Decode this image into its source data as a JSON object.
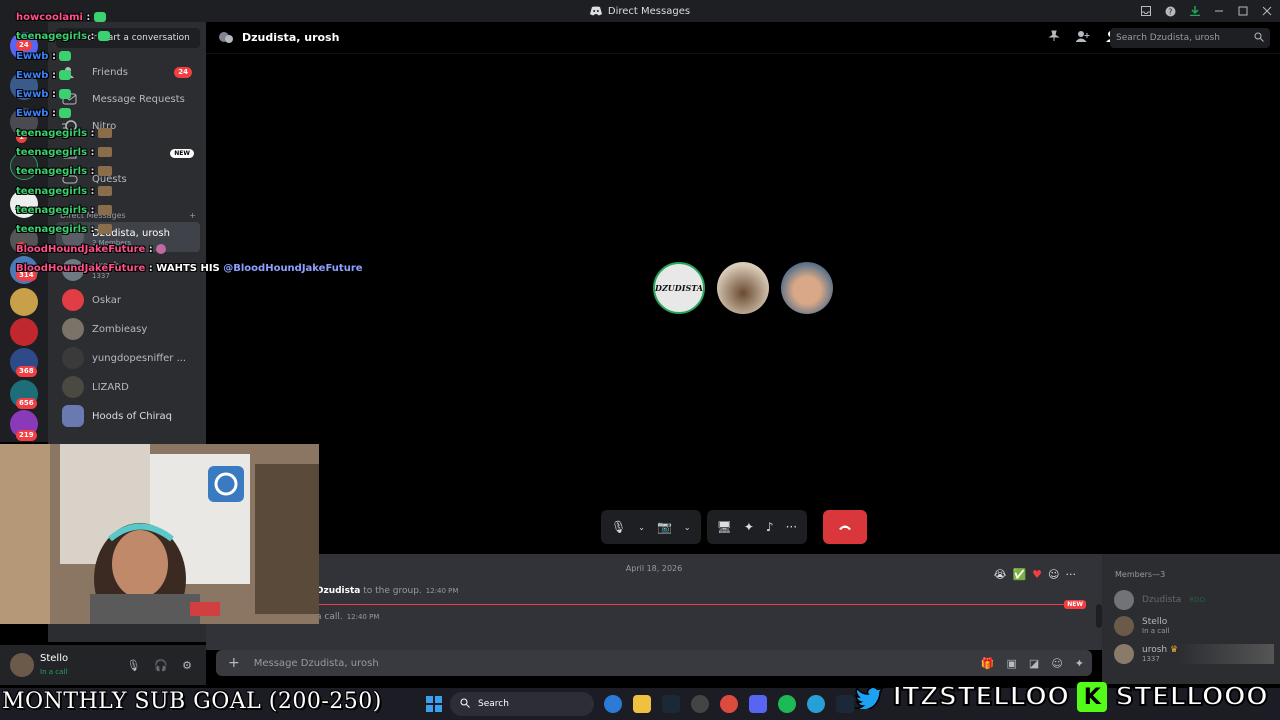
{
  "window": {
    "title": "Direct Messages"
  },
  "sidebar": {
    "search_placeholder": "Find or start a conversation",
    "nav": [
      {
        "label": "Friends",
        "badge": "24"
      },
      {
        "label": "Message Requests"
      },
      {
        "label": "Nitro"
      },
      {
        "label": "",
        "badge": "NEW"
      },
      {
        "label": "Quests"
      }
    ],
    "dm_heading": "Direct Messages",
    "dms": [
      {
        "label": "Dzudista, urosh",
        "sub": "3 Members"
      },
      {
        "label": "urosh",
        "sub": "1337"
      },
      {
        "label": "Oskar"
      },
      {
        "label": "Zombieasy"
      },
      {
        "label": "yungdopesniffer ..."
      },
      {
        "label": "LIZARD"
      },
      {
        "label": "Hoods of Chiraq"
      }
    ]
  },
  "rail": {
    "badges": [
      "24",
      "1",
      "3",
      "314",
      "368",
      "656",
      "219"
    ]
  },
  "user": {
    "name": "Stello",
    "status": "In a call"
  },
  "header": {
    "channel": "Dzudista, urosh",
    "search_placeholder": "Search Dzudista, urosh"
  },
  "chat": {
    "date": "April 18, 2026",
    "line1_name": "Dzudista",
    "line1_text": " to the group.",
    "line1_time": "12:40 PM",
    "line2_text": "a call.",
    "line2_time": "12:40 PM",
    "new_tag": "NEW",
    "composer_placeholder": "Message Dzudista, urosh"
  },
  "members": {
    "heading": "Members—3",
    "list": [
      {
        "name": "Dzudista",
        "tag": "RDO"
      },
      {
        "name": "Stello",
        "sub": "In a call"
      },
      {
        "name": "urosh",
        "sub": "1337"
      }
    ]
  },
  "participants": {
    "first_label": "DZUDISTA"
  },
  "overlay": {
    "lines": [
      {
        "user": "howcoolami",
        "color": "#ff4f8b",
        "msg": ""
      },
      {
        "user": "teenagegirls",
        "color": "#3bd16f",
        "msg": ""
      },
      {
        "user": "Ewwb",
        "color": "#3b82f6",
        "msg": ""
      },
      {
        "user": "Ewwb",
        "color": "#3b82f6",
        "msg": ""
      },
      {
        "user": "Ewwb",
        "color": "#3b82f6",
        "msg": ""
      },
      {
        "user": "Ewwb",
        "color": "#3b82f6",
        "msg": ""
      },
      {
        "user": "teenagegirls",
        "color": "#3bd16f",
        "msg": ""
      },
      {
        "user": "teenagegirls",
        "color": "#3bd16f",
        "msg": ""
      },
      {
        "user": "teenagegirls",
        "color": "#3bd16f",
        "msg": ""
      },
      {
        "user": "teenagegirls",
        "color": "#3bd16f",
        "msg": ""
      },
      {
        "user": "teenagegirls",
        "color": "#3bd16f",
        "msg": ""
      },
      {
        "user": "teenagegirls",
        "color": "#3bd16f",
        "msg": ""
      },
      {
        "user": "BloodHoundJakeFuture",
        "color": "#ff4f8b",
        "msg": ""
      },
      {
        "user": "BloodHoundJakeFuture",
        "color": "#ff4f8b",
        "msg": "WAHTS HIS",
        "mention": "@BloodHoundJakeFuture"
      }
    ]
  },
  "taskbar": {
    "search": "Search"
  },
  "stream": {
    "sub_goal": "MONTHLY SUB GOAL (200-250)",
    "twitter": "ITZSTELLOO",
    "kick": "STELLOOO"
  },
  "colors": {
    "accent": "#5865f2",
    "danger": "#da373c",
    "online": "#23a55a"
  }
}
